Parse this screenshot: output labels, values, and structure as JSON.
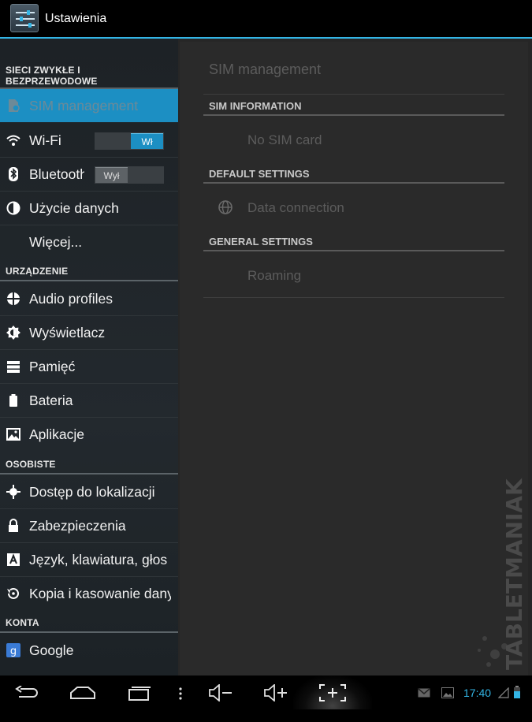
{
  "app": {
    "title": "Ustawienia"
  },
  "sidebar": {
    "section_wireless": "SIECI ZWYKŁE I BEZPRZEWODOWE",
    "sim": "SIM management",
    "wifi": {
      "label": "Wi-Fi",
      "toggle": "Wł"
    },
    "bluetooth": {
      "label": "Bluetooth",
      "toggle": "Wył"
    },
    "data_usage": "Użycie danych",
    "more": "Więcej...",
    "section_device": "URZĄDZENIE",
    "audio": "Audio profiles",
    "display": "Wyświetlacz",
    "storage": "Pamięć",
    "battery": "Bateria",
    "apps": "Aplikacje",
    "section_personal": "OSOBISTE",
    "location": "Dostęp do lokalizacji",
    "security": "Zabezpieczenia",
    "language": "Język, klawiatura, głos",
    "backup": "Kopia i kasowanie danych",
    "section_accounts": "KONTA",
    "google": "Google"
  },
  "detail": {
    "title": "SIM management",
    "sim_info_header": "SIM INFORMATION",
    "no_sim": "No SIM card",
    "default_header": "DEFAULT SETTINGS",
    "data_connection": "Data connection",
    "general_header": "GENERAL SETTINGS",
    "roaming": "Roaming"
  },
  "statusbar": {
    "time": "17:40"
  },
  "watermark": {
    "text": "TABLETMANIAK"
  },
  "colors": {
    "accent": "#33b5e5",
    "selected": "#1c8fc3"
  }
}
